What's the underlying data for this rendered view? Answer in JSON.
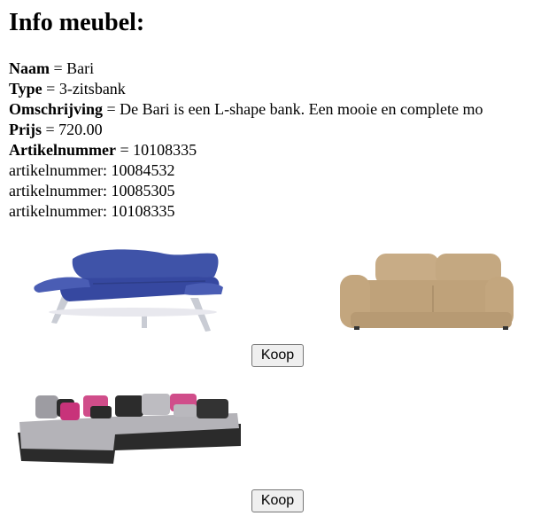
{
  "page": {
    "heading": "Info meubel:"
  },
  "info": {
    "naam_label": "Naam",
    "naam_value": " = Bari",
    "type_label": "Type",
    "type_value": " = 3-zitsbank",
    "omschrijving_label": "Omschrijving",
    "omschrijving_value": " = De Bari is een L-shape bank. Een mooie en complete mo",
    "prijs_label": "Prijs",
    "prijs_value": " = 720.00",
    "artikelnummer_label": "Artikelnummer",
    "artikelnummer_value": " = 10108335",
    "artikel_lines": [
      "artikelnummer: 10084532",
      "artikelnummer: 10085305",
      "artikelnummer: 10108335"
    ]
  },
  "products": [
    {
      "image": "blue-sofa-image",
      "color": "#3b4ea3"
    },
    {
      "image": "beige-leather-sofa-image",
      "color": "#c9ae8a"
    },
    {
      "image": "corner-sofa-image",
      "color": "#9a9a9a"
    }
  ],
  "buttons": {
    "koop_label": "Koop"
  }
}
